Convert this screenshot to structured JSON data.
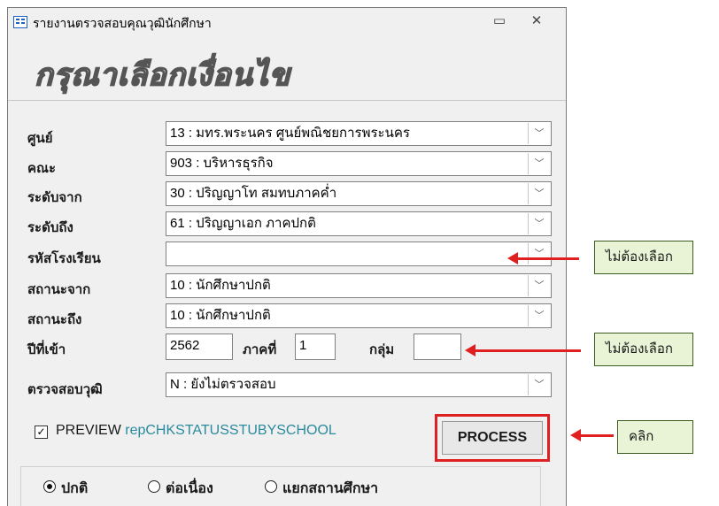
{
  "window": {
    "title": "รายงานตรวจสอบคุณวุฒินักศึกษา",
    "minimize": "▭",
    "close": "✕"
  },
  "heading": "กรุณาเลือกเงื่อนไข",
  "form": {
    "center": {
      "label": "ศูนย์",
      "value": "13 : มทร.พระนคร ศูนย์พณิชยการพระนคร"
    },
    "faculty": {
      "label": "คณะ",
      "value": "903 : บริหารธุรกิจ"
    },
    "level_from": {
      "label": "ระดับจาก",
      "value": "30 : ปริญญาโท สมทบภาคค่ำ"
    },
    "level_to": {
      "label": "ระดับถึง",
      "value": "61 : ปริญญาเอก ภาคปกติ"
    },
    "school_code": {
      "label": "รหัสโรงเรียน",
      "value": ""
    },
    "status_from": {
      "label": "สถานะจาก",
      "value": "10 : นักศึกษาปกติ"
    },
    "status_to": {
      "label": "สถานะถึง",
      "value": "10 : นักศึกษาปกติ"
    },
    "entry_year": {
      "label": "ปีที่เข้า",
      "value": "2562"
    },
    "semester": {
      "label": "ภาคที่",
      "value": "1"
    },
    "group": {
      "label": "กลุ่ม",
      "value": ""
    },
    "check_degree": {
      "label": "ตรวจสอบวุฒิ",
      "value": "N : ยังไม่ตรวจสอบ"
    }
  },
  "preview": {
    "checked": true,
    "check_glyph": "✓",
    "label": "PREVIEW",
    "report": "repCHKSTATUSSTUBYSCHOOL"
  },
  "process_label": "PROCESS",
  "options": [
    {
      "label": "ปกติ",
      "selected": true
    },
    {
      "label": "ต่อเนื่อง",
      "selected": false
    },
    {
      "label": "แยกสถานศึกษา",
      "selected": false
    }
  ],
  "annotations": {
    "note1": "ไม่ต้องเลือก",
    "note2": "ไม่ต้องเลือก",
    "note3": "คลิก",
    "accent": "#e02020",
    "note_bg": "#e9f3d5"
  },
  "dropdown_glyph": "﹀"
}
